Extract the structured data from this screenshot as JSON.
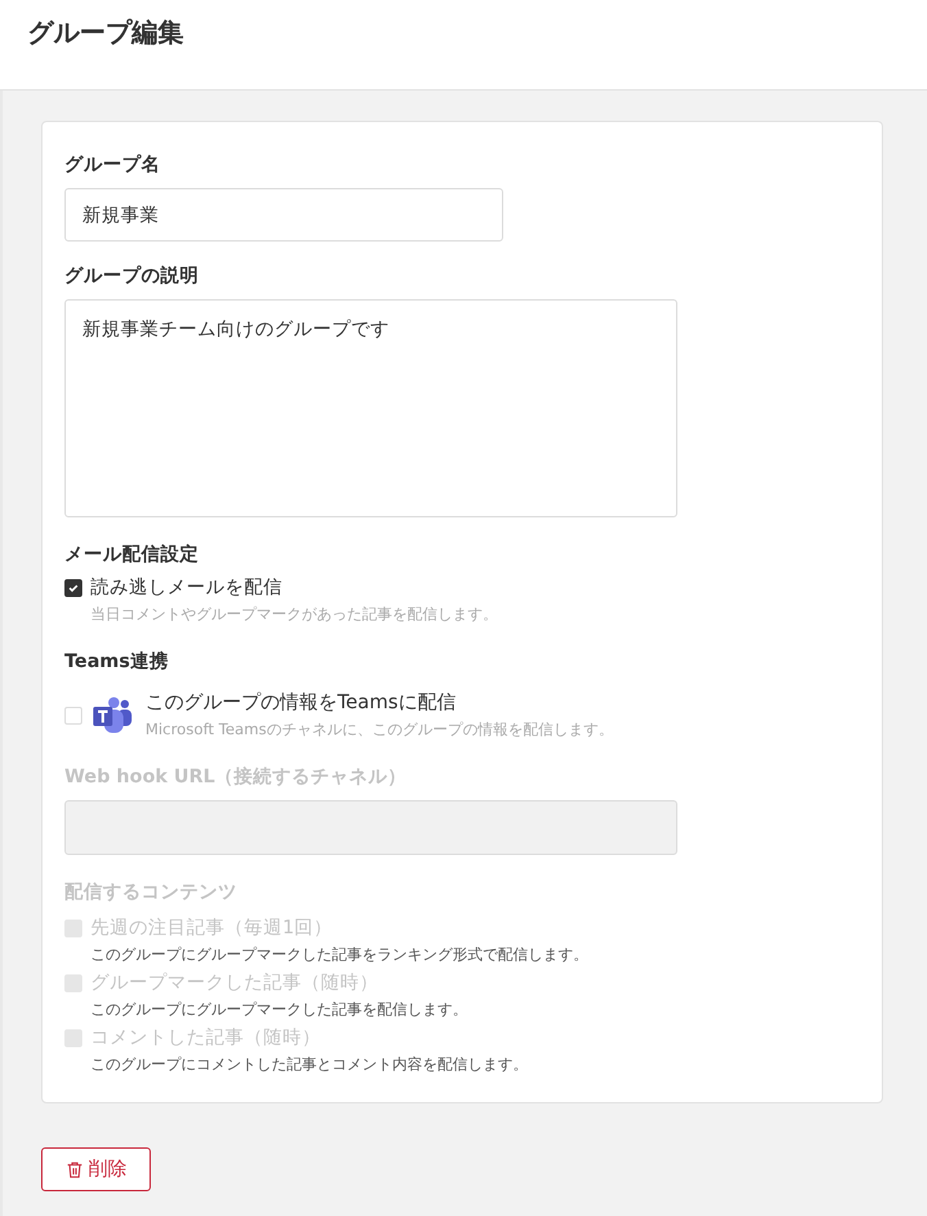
{
  "page_title": "グループ編集",
  "name_field": {
    "label": "グループ名",
    "value": "新規事業"
  },
  "description_field": {
    "label": "グループの説明",
    "value": "新規事業チーム向けのグループです"
  },
  "mail": {
    "heading": "メール配信設定",
    "option": {
      "label": "読み逃しメールを配信",
      "description": "当日コメントやグループマークがあった記事を配信します。",
      "checked": true,
      "disabled": false
    }
  },
  "teams": {
    "heading": "Teams連携",
    "option": {
      "label": "このグループの情報をTeamsに配信",
      "description": "Microsoft Teamsのチャネルに、このグループの情報を配信します。",
      "checked": false,
      "disabled": false
    },
    "webhook": {
      "label": "Web hook URL（接続するチャネル）",
      "disabled": true
    },
    "contents_heading": "配信するコンテンツ",
    "contents": [
      {
        "label": "先週の注目記事（毎週1回）",
        "description": "このグループにグループマークした記事をランキング形式で配信します。",
        "checked": false,
        "disabled": true
      },
      {
        "label": "グループマークした記事（随時）",
        "description": "このグループにグループマークした記事を配信します。",
        "checked": false,
        "disabled": true
      },
      {
        "label": "コメントした記事（随時）",
        "description": "このグループにコメントした記事とコメント内容を配信します。",
        "checked": false,
        "disabled": true
      }
    ]
  },
  "delete_button": "削除"
}
